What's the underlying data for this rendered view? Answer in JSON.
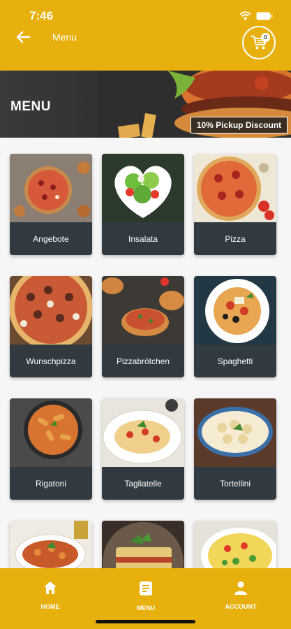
{
  "status_bar": {
    "time": "7:46"
  },
  "header": {
    "title": "Menu",
    "cart_count": "0"
  },
  "banner": {
    "title": "MENU",
    "discount": "10% Pickup Discount"
  },
  "categories": [
    {
      "label": "Angebote"
    },
    {
      "label": "Insalata"
    },
    {
      "label": "Pizza"
    },
    {
      "label": "Wunschpizza"
    },
    {
      "label": "Pizzabrötchen"
    },
    {
      "label": "Spaghetti"
    },
    {
      "label": "Rigatoni"
    },
    {
      "label": "Tagliatelle"
    },
    {
      "label": "Tortellini"
    },
    {
      "label": ""
    },
    {
      "label": ""
    },
    {
      "label": ""
    }
  ],
  "bottom_nav": {
    "home": "HOME",
    "menu": "MENU",
    "account": "ACCOUNT"
  },
  "colors": {
    "brand": "#e8b00c",
    "card_label_bg": "#303a40"
  },
  "icons": {
    "back": "arrow-left-icon",
    "cart": "cart-icon",
    "home": "home-icon",
    "menu": "menu-document-icon",
    "account": "person-icon"
  }
}
